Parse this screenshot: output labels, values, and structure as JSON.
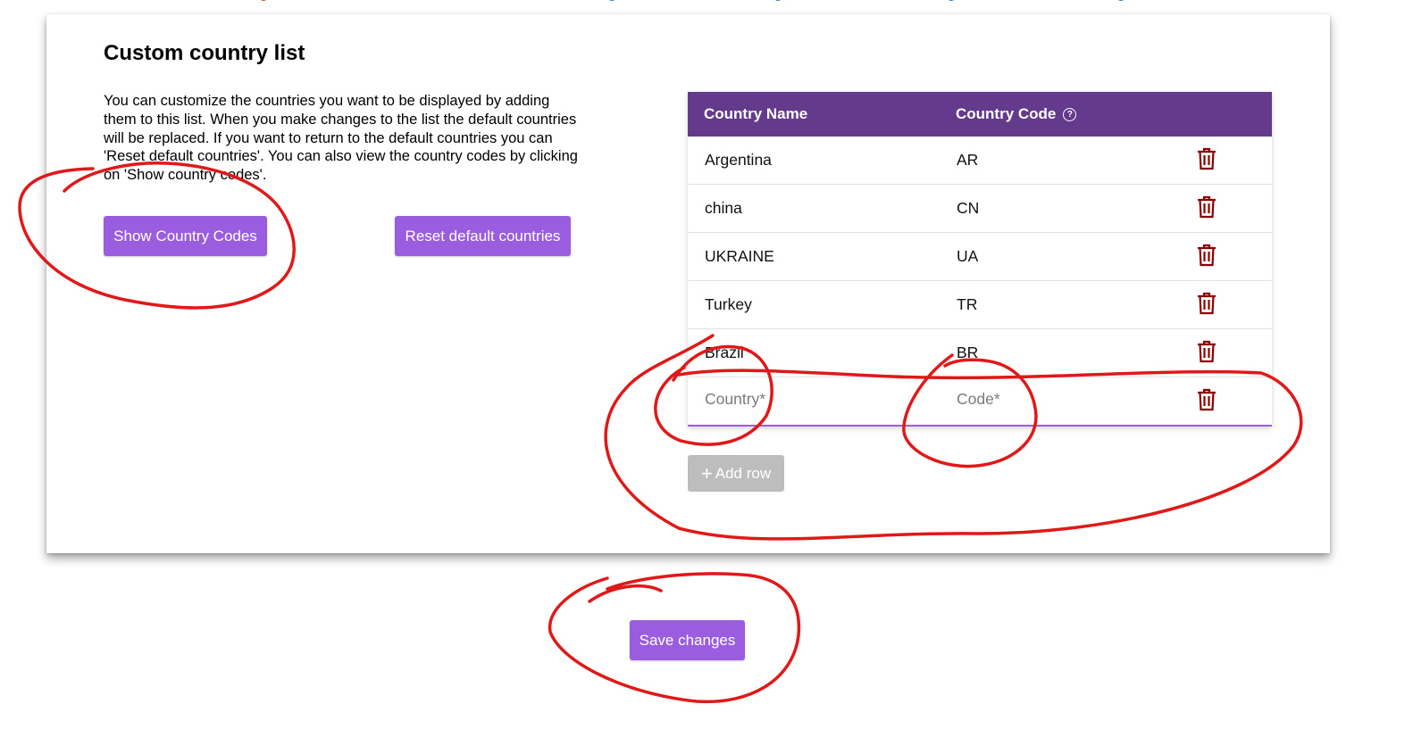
{
  "panel": {
    "title": "Custom country list",
    "description": "You can customize the countries you want to be displayed by adding them to this list. When you make changes to the list the default countries will be replaced. If you want to return to the default countries you can 'Reset default countries'. You can also view the country codes by clicking on 'Show country codes'.",
    "show_codes_label": "Show Country Codes",
    "reset_label": "Reset default countries"
  },
  "table": {
    "headers": {
      "name": "Country Name",
      "code": "Country Code",
      "help_icon": "help-circle-icon"
    },
    "rows": [
      {
        "name": "Argentina",
        "code": "AR"
      },
      {
        "name": "china",
        "code": "CN"
      },
      {
        "name": "UKRAINE",
        "code": "UA"
      },
      {
        "name": "Turkey",
        "code": "TR"
      },
      {
        "name": "Brazil",
        "code": "BR"
      }
    ],
    "new_row": {
      "name_value": "",
      "name_placeholder": "Country*",
      "code_value": "",
      "code_placeholder": "Code*"
    },
    "delete_icon": "trash-icon",
    "add_row_label": "Add row",
    "add_icon": "plus-icon"
  },
  "footer": {
    "save_label": "Save changes"
  },
  "colors": {
    "accent": "#9b5de0",
    "header_bg": "#643a8c",
    "delete": "#8b0000",
    "disabled": "#bdbdbd",
    "annotation": "#e01818"
  }
}
